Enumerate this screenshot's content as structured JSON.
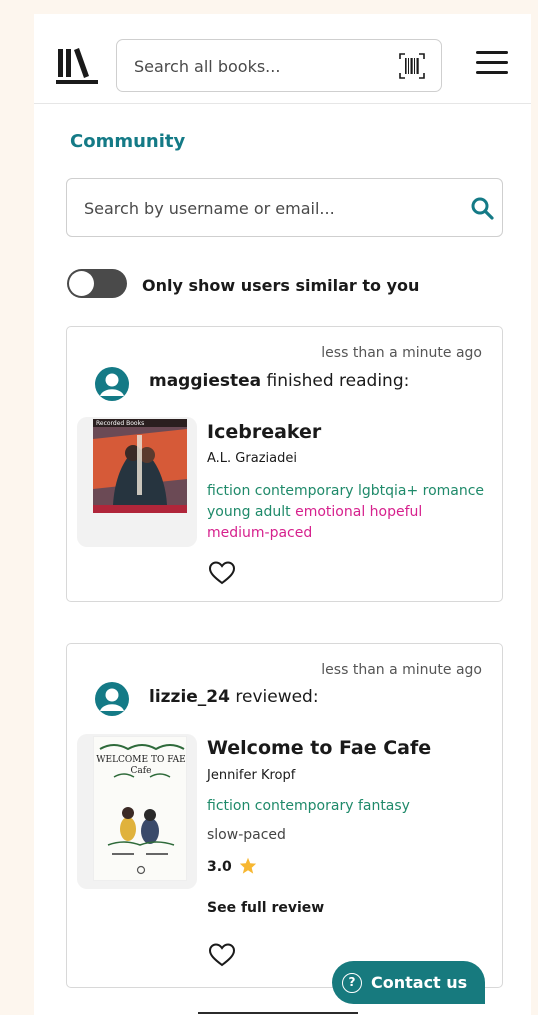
{
  "header": {
    "search_placeholder": "Search all books...",
    "logo_icon": "library-books-icon",
    "barcode_icon": "barcode-scan-icon",
    "menu_icon": "hamburger-menu-icon"
  },
  "page": {
    "title": "Community",
    "user_search_placeholder": "Search by username or email...",
    "search_icon": "search-icon",
    "toggle_label": "Only show users similar to you",
    "toggle_on": false
  },
  "feed": [
    {
      "time": "less than a minute ago",
      "username": "maggiestea",
      "action": "finished reading:",
      "book_title": "Icebreaker",
      "author": "A.L. Graziadei",
      "genre_tags": "fiction contemporary lgbtqia+ romance young adult",
      "mood_tags": "emotional hopeful medium-paced",
      "cover_label": "Recorded Books"
    },
    {
      "time": "less than a minute ago",
      "username": "lizzie_24",
      "action": "reviewed:",
      "book_title": "Welcome to Fae Cafe",
      "author": "Jennifer Kropf",
      "genre_tags": "fiction contemporary fantasy",
      "pace": "slow-paced",
      "rating": "3.0",
      "full_review_link": "See full review",
      "cover_title": "WELCOME TO FAE Cafe"
    }
  ],
  "contact": {
    "label": "Contact us",
    "icon": "help-circle-icon"
  },
  "colors": {
    "accent": "#147a86",
    "genre_tag": "#1f8a6a",
    "mood_tag": "#d6218d",
    "page_bg": "#fdf6ee",
    "contact_bg": "#177a7e",
    "star": "#f7b731"
  }
}
